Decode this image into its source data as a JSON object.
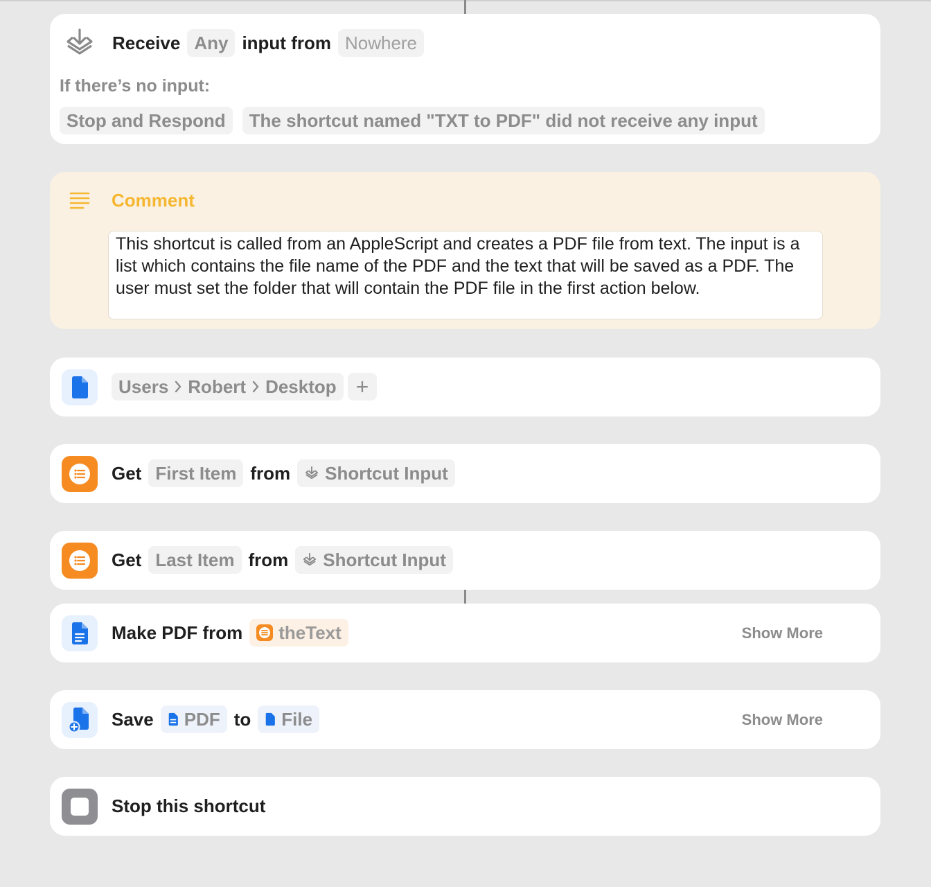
{
  "receive": {
    "label": "Receive",
    "type": "Any",
    "mid": "input from",
    "source": "Nowhere",
    "no_input_label": "If there’s no input:",
    "action": "Stop and Respond",
    "message": "The shortcut named \"TXT to PDF\" did not receive any input",
    "icon": "receive-icon"
  },
  "comment": {
    "title": "Comment",
    "text": "This shortcut is called from an AppleScript and creates a PDF file from text. The input is a list which contains the file name of the PDF and the text that will be saved as a PDF. The user must set the folder that will contain the PDF file in the first action below.",
    "icon": "lines-icon",
    "accent": "#f5b731"
  },
  "folder": {
    "path": [
      "Users",
      "Robert",
      "Desktop"
    ],
    "add_label": "+",
    "icon": "document-icon"
  },
  "get_first": {
    "verb": "Get",
    "item": "First Item",
    "mid": "from",
    "source": "Shortcut Input",
    "icon": "list-icon"
  },
  "get_last": {
    "verb": "Get",
    "item": "Last Item",
    "mid": "from",
    "source": "Shortcut Input",
    "icon": "list-icon"
  },
  "make_pdf": {
    "label": "Make PDF from",
    "var": "theText",
    "show_more": "Show More",
    "icon": "document-text-icon"
  },
  "save": {
    "verb": "Save",
    "what": "PDF",
    "mid": "to",
    "where": "File",
    "show_more": "Show More",
    "icon": "save-document-icon"
  },
  "stop": {
    "label": "Stop this shortcut",
    "icon": "stop-icon"
  },
  "colors": {
    "background": "#e8e8e8",
    "blue": "#1a73e8",
    "orange": "#f68b22",
    "gray": "#8c8c8c"
  }
}
